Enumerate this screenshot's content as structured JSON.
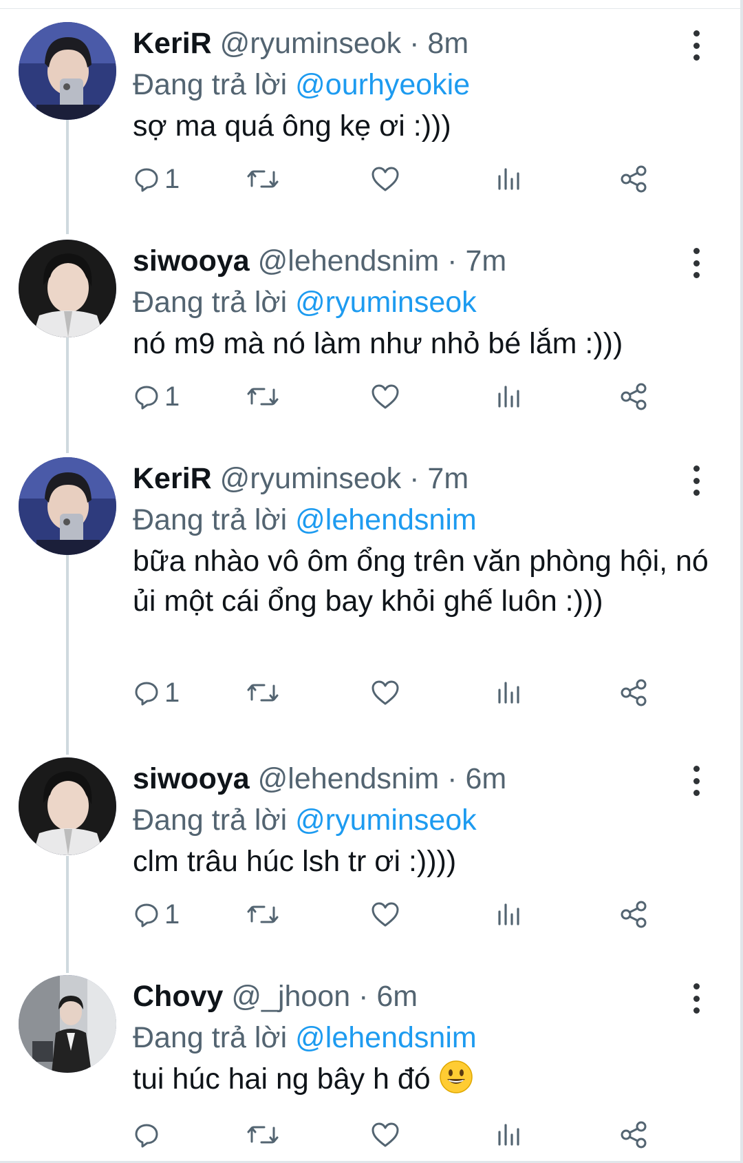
{
  "tweets": [
    {
      "name": "KeriR",
      "handle": "@ryuminseok",
      "dot": "·",
      "time": "8m",
      "replying_label": "Đang trả lời",
      "replying_to": "@ourhyeokie",
      "text": "sợ ma quá ông kẹ ơi :)))",
      "reply_count": "1",
      "avatar": "keri"
    },
    {
      "name": "siwooya",
      "handle": "@lehendsnim",
      "dot": "·",
      "time": "7m",
      "replying_label": "Đang trả lời",
      "replying_to": "@ryuminseok",
      "text": "nó m9 mà nó làm như nhỏ bé lắm :)))",
      "reply_count": "1",
      "avatar": "siwooya"
    },
    {
      "name": "KeriR",
      "handle": "@ryuminseok",
      "dot": "·",
      "time": "7m",
      "replying_label": "Đang trả lời",
      "replying_to": "@lehendsnim",
      "text": "bữa nhào vô ôm ổng trên văn phòng hội, nó ủi một cái ổng bay khỏi ghế luôn :)))",
      "reply_count": "1",
      "avatar": "keri"
    },
    {
      "name": "siwooya",
      "handle": "@lehendsnim",
      "dot": "·",
      "time": "6m",
      "replying_label": "Đang trả lời",
      "replying_to": "@ryuminseok",
      "text": "clm trâu húc lsh tr ơi :))))",
      "reply_count": "1",
      "avatar": "siwooya"
    },
    {
      "name": "Chovy",
      "handle": "@_jhoon",
      "dot": "·",
      "time": "6m",
      "replying_label": "Đang trả lời",
      "replying_to": "@lehendsnim",
      "text": "tui húc hai ng bây h đó",
      "emoji": "grinning-face",
      "reply_count": "",
      "avatar": "chovy"
    }
  ],
  "icons": {
    "reply": "reply-icon",
    "retweet": "retweet-icon",
    "like": "heart-icon",
    "analytics": "analytics-icon",
    "share": "share-icon",
    "more": "more-vertical-icon"
  },
  "colors": {
    "link": "#1d9bf0",
    "secondary_text": "#536471",
    "thread_line": "#cfd9de"
  }
}
